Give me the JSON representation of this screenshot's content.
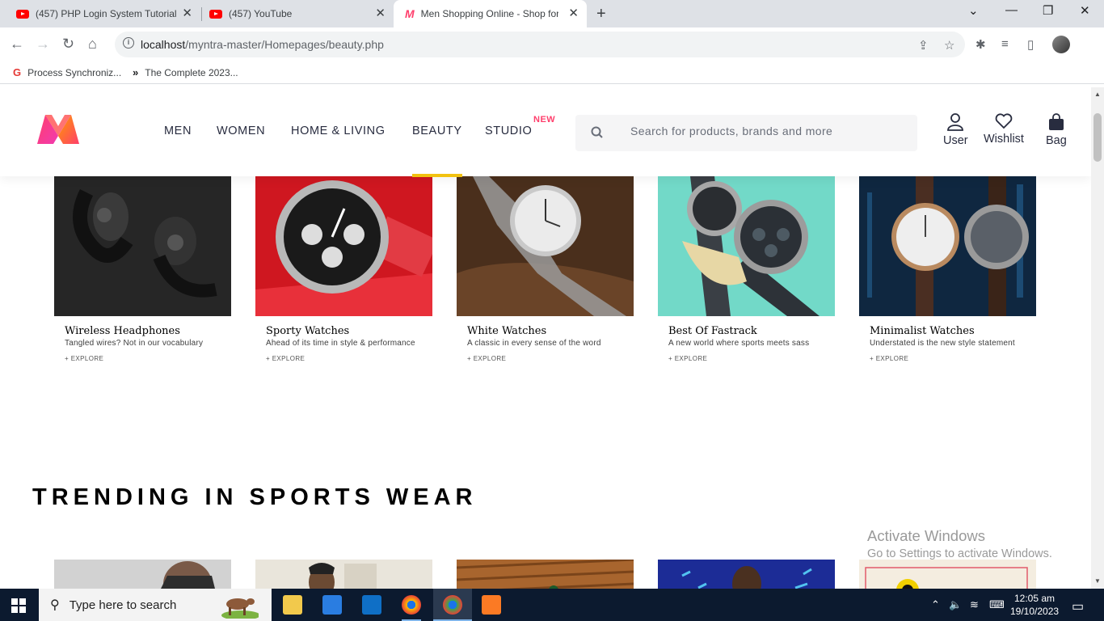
{
  "browser": {
    "tabs": [
      {
        "title": "(457) PHP Login System Tutorial",
        "icon": "youtube-icon"
      },
      {
        "title": "(457) YouTube",
        "icon": "youtube-icon"
      },
      {
        "title": "Men Shopping Online - Shop for",
        "icon": "myntra-icon"
      }
    ],
    "url_host": "localhost",
    "url_path": "/myntra-master/Homepages/beauty.php",
    "bookmarks": [
      {
        "label": "Process Synchroniz...",
        "icon": "g-icon"
      },
      {
        "label": "The Complete 2023...",
        "icon": "chevron-icon"
      }
    ]
  },
  "site": {
    "nav": [
      "MEN",
      "WOMEN",
      "HOME & LIVING",
      "BEAUTY",
      "STUDIO"
    ],
    "new_badge": "NEW",
    "search_placeholder": "Search for products, brands and more",
    "actions": [
      "User",
      "Wishlist",
      "Bag"
    ],
    "accent": "#ff3f6c",
    "active_underline": "#f2c210"
  },
  "products": [
    {
      "name": "Wireless Headphones",
      "desc": "Tangled wires? Not in our vocabulary",
      "cta": "+ EXPLORE"
    },
    {
      "name": "Sporty Watches",
      "desc": "Ahead of its time in style & performance",
      "cta": "+ EXPLORE"
    },
    {
      "name": "White Watches",
      "desc": "A classic in every sense of the word",
      "cta": "+ EXPLORE"
    },
    {
      "name": "Best Of Fastrack",
      "desc": "A new world where sports meets sass",
      "cta": "+ EXPLORE"
    },
    {
      "name": "Minimalist Watches",
      "desc": "Understated is the new style statement",
      "cta": "+ EXPLORE"
    }
  ],
  "section_title": "TRENDING IN SPORTS WEAR",
  "watermark": {
    "line1": "Activate Windows",
    "line2": "Go to Settings to activate Windows."
  },
  "taskbar": {
    "search_placeholder": "Type here to search",
    "time": "12:05 am",
    "date": "19/10/2023"
  }
}
